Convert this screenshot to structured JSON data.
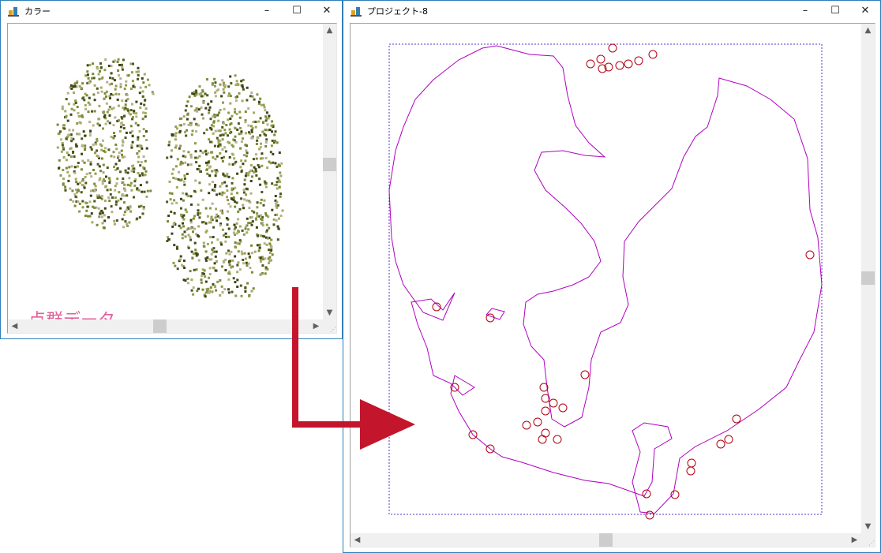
{
  "windows": {
    "color": {
      "title": "カラー",
      "minimize": "–",
      "maximize": "☐",
      "close": "✕"
    },
    "project": {
      "title": "プロジェクト-8",
      "minimize": "–",
      "maximize": "☐",
      "close": "✕"
    }
  },
  "annotation": {
    "label": "点群データ",
    "label_color": "#e0609a",
    "arrow_color": "#c3152c"
  },
  "scroll": {
    "up": "▲",
    "down": "▼",
    "left": "◀",
    "right": "▶",
    "grip": "⋰"
  },
  "colors": {
    "window_border": "#2f7fb8",
    "contour": "#b000c0",
    "trees": "#b00010",
    "bbox": "#5a30d0",
    "foliage_dark": "#4c5a1e",
    "foliage_mid": "#7a8a34",
    "foliage_light": "#a6a860"
  },
  "icons": {
    "app": "app-icon",
    "arrow": "arrow-icon"
  }
}
